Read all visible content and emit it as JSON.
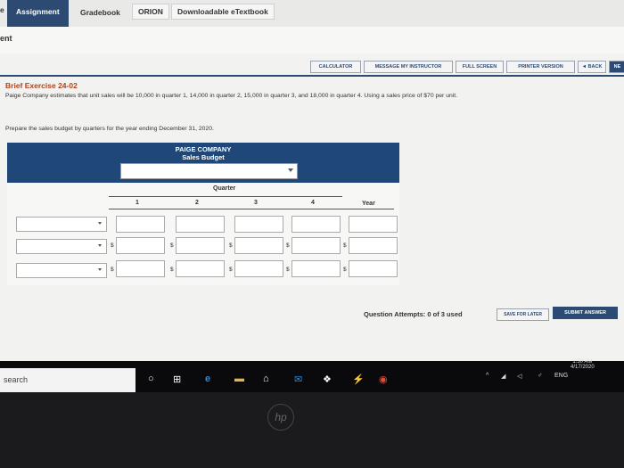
{
  "tabs": {
    "prev_partial": "e",
    "assignment": "Assignment",
    "gradebook": "Gradebook",
    "orion": "ORION",
    "etextbook": "Downloadable eTextbook"
  },
  "header": {
    "title_partial": "ent"
  },
  "toolbar": {
    "calculator": "CALCULATOR",
    "message": "MESSAGE MY INSTRUCTOR",
    "fullscreen": "FULL SCREEN",
    "printer": "PRINTER VERSION",
    "back": "◄ BACK",
    "next": "NE"
  },
  "exercise": {
    "title": "Brief Exercise 24-02",
    "text": "Paige Company estimates that unit sales will be 10,000 in quarter 1, 14,000 in quarter 2, 15,000 in quarter 3, and 18,000 in quarter 4. Using a sales price of $70 per unit.",
    "prompt": "Prepare the sales budget by quarters for the year ending December 31, 2020."
  },
  "budget": {
    "company": "PAIGE COMPANY",
    "title": "Sales Budget",
    "quarter_label": "Quarter",
    "columns": [
      "1",
      "2",
      "3",
      "4"
    ],
    "year_label": "Year",
    "dollar": "$"
  },
  "footer": {
    "attempts": "Question Attempts: 0 of 3 used",
    "save": "SAVE FOR LATER",
    "submit": "SUBMIT ANSWER"
  },
  "taskbar": {
    "search": "search",
    "lang": "ENG",
    "time": "1:30 AM",
    "date": "4/17/2020"
  },
  "laptop": {
    "logo": "hp"
  }
}
